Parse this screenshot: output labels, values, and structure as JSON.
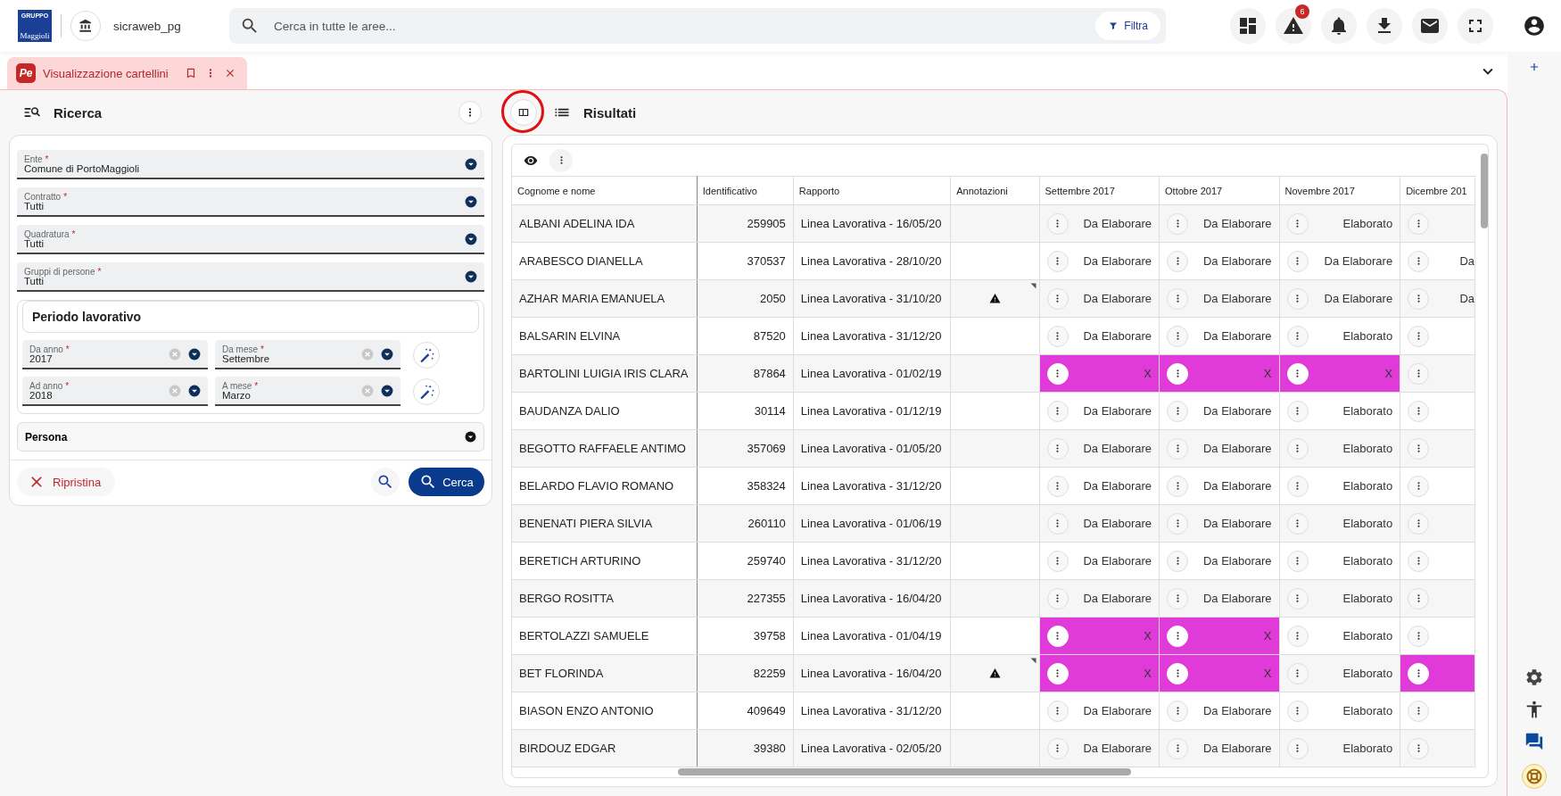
{
  "header": {
    "logo": {
      "top": "GRUPPO",
      "bottom": "Maggioli"
    },
    "org": "sicraweb_pg",
    "search": {
      "placeholder": "Cerca in tutte le aree..."
    },
    "filter_button": "Filtra",
    "actions": [
      {
        "kind": "dashboard"
      },
      {
        "kind": "alerts",
        "badge": "6"
      },
      {
        "kind": "bell"
      },
      {
        "kind": "download"
      },
      {
        "kind": "mail"
      },
      {
        "kind": "fullscreen"
      }
    ]
  },
  "tabs": [
    {
      "icon_text": "Pe",
      "label": "Visualizzazione cartellini",
      "selected": true
    }
  ],
  "search_panel": {
    "title": "Ricerca",
    "fields": [
      {
        "label": "Ente",
        "required": true,
        "value": "Comune di PortoMaggioli"
      },
      {
        "label": "Contratto",
        "required": true,
        "value": "Tutti"
      },
      {
        "label": "Quadratura",
        "required": true,
        "value": "Tutti"
      },
      {
        "label": "Gruppi di persone",
        "required": true,
        "value": "Tutti"
      }
    ],
    "period": {
      "title": "Periodo lavorativo",
      "rows": [
        [
          {
            "label": "Da anno",
            "required": true,
            "value": "2017"
          },
          {
            "label": "Da mese",
            "required": true,
            "value": "Settembre"
          }
        ],
        [
          {
            "label": "Ad anno",
            "required": true,
            "value": "2018"
          },
          {
            "label": "A mese",
            "required": true,
            "value": "Marzo"
          }
        ]
      ]
    },
    "required_marker": "*",
    "persona": "Persona",
    "reset_button": "Ripristina",
    "search_button": "Cerca"
  },
  "results": {
    "title": "Risultati",
    "toggle_highlighted": true,
    "columns": [
      "Cognome e nome",
      "Identificativo",
      "Rapporto",
      "Annotazioni",
      "Settembre 2017",
      "Ottobre 2017",
      "Novembre 2017",
      "Dicembre 201"
    ],
    "rows": [
      {
        "name": "ALBANI ADELINA IDA",
        "id": "259905",
        "rapporto": "Linea Lavorativa - 16/05/20",
        "warning": false,
        "months": [
          {
            "kind": "status",
            "text": "Da Elaborare"
          },
          {
            "kind": "status",
            "text": "Da Elaborare"
          },
          {
            "kind": "status",
            "text": "Elaborato"
          },
          {
            "kind": "status"
          }
        ]
      },
      {
        "name": "ARABESCO DIANELLA",
        "id": "370537",
        "rapporto": "Linea Lavorativa - 28/10/20",
        "warning": false,
        "months": [
          {
            "kind": "status",
            "text": "Da Elaborare"
          },
          {
            "kind": "status",
            "text": "Da Elaborare"
          },
          {
            "kind": "status",
            "text": "Da Elaborare"
          },
          {
            "kind": "status",
            "text": "Da"
          }
        ]
      },
      {
        "name": "AZHAR MARIA EMANUELA",
        "id": "2050",
        "rapporto": "Linea Lavorativa - 31/10/20",
        "warning": true,
        "months": [
          {
            "kind": "status",
            "text": "Da Elaborare"
          },
          {
            "kind": "status",
            "text": "Da Elaborare"
          },
          {
            "kind": "status",
            "text": "Da Elaborare"
          },
          {
            "kind": "status",
            "text": "Da"
          }
        ]
      },
      {
        "name": "BALSARIN ELVINA",
        "id": "87520",
        "rapporto": "Linea Lavorativa - 31/12/20",
        "warning": false,
        "months": [
          {
            "kind": "status",
            "text": "Da Elaborare"
          },
          {
            "kind": "status",
            "text": "Da Elaborare"
          },
          {
            "kind": "status",
            "text": "Elaborato"
          },
          {
            "kind": "status"
          }
        ]
      },
      {
        "name": "BARTOLINI LUIGIA IRIS CLARA",
        "id": "87864",
        "rapporto": "Linea Lavorativa - 01/02/19",
        "warning": false,
        "months": [
          {
            "kind": "error",
            "text": "X"
          },
          {
            "kind": "error",
            "text": "X"
          },
          {
            "kind": "error",
            "text": "X"
          },
          {
            "kind": "status"
          }
        ]
      },
      {
        "name": "BAUDANZA DALIO",
        "id": "30114",
        "rapporto": "Linea Lavorativa - 01/12/19",
        "warning": false,
        "months": [
          {
            "kind": "status",
            "text": "Da Elaborare"
          },
          {
            "kind": "status",
            "text": "Da Elaborare"
          },
          {
            "kind": "status",
            "text": "Elaborato"
          },
          {
            "kind": "status"
          }
        ]
      },
      {
        "name": "BEGOTTO RAFFAELE ANTIMO",
        "id": "357069",
        "rapporto": "Linea Lavorativa - 01/05/20",
        "warning": false,
        "months": [
          {
            "kind": "status",
            "text": "Da Elaborare"
          },
          {
            "kind": "status",
            "text": "Da Elaborare"
          },
          {
            "kind": "status",
            "text": "Elaborato"
          },
          {
            "kind": "status"
          }
        ]
      },
      {
        "name": "BELARDO FLAVIO ROMANO",
        "id": "358324",
        "rapporto": "Linea Lavorativa - 31/12/20",
        "warning": false,
        "months": [
          {
            "kind": "status",
            "text": "Da Elaborare"
          },
          {
            "kind": "status",
            "text": "Da Elaborare"
          },
          {
            "kind": "status",
            "text": "Elaborato"
          },
          {
            "kind": "status"
          }
        ]
      },
      {
        "name": "BENENATI PIERA SILVIA",
        "id": "260110",
        "rapporto": "Linea Lavorativa - 01/06/19",
        "warning": false,
        "months": [
          {
            "kind": "status",
            "text": "Da Elaborare"
          },
          {
            "kind": "status",
            "text": "Da Elaborare"
          },
          {
            "kind": "status",
            "text": "Elaborato"
          },
          {
            "kind": "status"
          }
        ]
      },
      {
        "name": "BERETICH ARTURINO",
        "id": "259740",
        "rapporto": "Linea Lavorativa - 31/12/20",
        "warning": false,
        "months": [
          {
            "kind": "status",
            "text": "Da Elaborare"
          },
          {
            "kind": "status",
            "text": "Da Elaborare"
          },
          {
            "kind": "status",
            "text": "Elaborato"
          },
          {
            "kind": "status"
          }
        ]
      },
      {
        "name": "BERGO ROSITTA",
        "id": "227355",
        "rapporto": "Linea Lavorativa - 16/04/20",
        "warning": false,
        "months": [
          {
            "kind": "status",
            "text": "Da Elaborare"
          },
          {
            "kind": "status",
            "text": "Da Elaborare"
          },
          {
            "kind": "status",
            "text": "Elaborato"
          },
          {
            "kind": "status"
          }
        ]
      },
      {
        "name": "BERTOLAZZI SAMUELE",
        "id": "39758",
        "rapporto": "Linea Lavorativa - 01/04/19",
        "warning": false,
        "months": [
          {
            "kind": "error",
            "text": "X"
          },
          {
            "kind": "error",
            "text": "X"
          },
          {
            "kind": "status",
            "text": "Elaborato"
          },
          {
            "kind": "status"
          }
        ]
      },
      {
        "name": "BET FLORINDA",
        "id": "82259",
        "rapporto": "Linea Lavorativa - 16/04/20",
        "warning": true,
        "months": [
          {
            "kind": "error",
            "text": "X"
          },
          {
            "kind": "error",
            "text": "X"
          },
          {
            "kind": "status",
            "text": "Elaborato"
          },
          {
            "kind": "error"
          }
        ]
      },
      {
        "name": "BIASON ENZO ANTONIO",
        "id": "409649",
        "rapporto": "Linea Lavorativa - 31/12/20",
        "warning": false,
        "months": [
          {
            "kind": "status",
            "text": "Da Elaborare"
          },
          {
            "kind": "status",
            "text": "Da Elaborare"
          },
          {
            "kind": "status",
            "text": "Elaborato"
          },
          {
            "kind": "status"
          }
        ]
      },
      {
        "name": "BIRDOUZ EDGAR",
        "id": "39380",
        "rapporto": "Linea Lavorativa - 02/05/20",
        "warning": false,
        "months": [
          {
            "kind": "status",
            "text": "Da Elaborare"
          },
          {
            "kind": "status",
            "text": "Da Elaborare"
          },
          {
            "kind": "status",
            "text": "Elaborato"
          },
          {
            "kind": "status"
          }
        ]
      }
    ]
  }
}
